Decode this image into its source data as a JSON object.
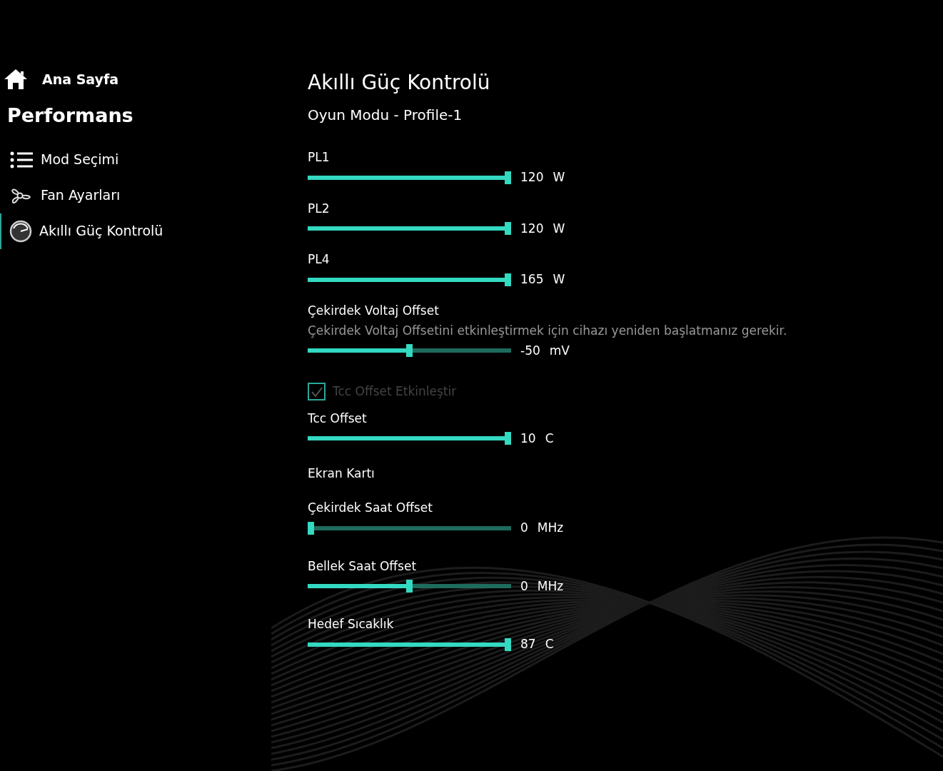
{
  "sidebar": {
    "home": "Ana Sayfa",
    "section": "Performans",
    "items": [
      {
        "label": "Mod Seçimi",
        "kind": "list",
        "selected": false
      },
      {
        "label": "Fan Ayarları",
        "kind": "fan",
        "selected": false
      },
      {
        "label": "Akıllı Güç Kontrolü",
        "kind": "gauge",
        "selected": true
      }
    ]
  },
  "main": {
    "title": "Akıllı Güç Kontrolü",
    "subtitle": "Oyun Modu - Profile-1",
    "controls": [
      {
        "kind": "slider",
        "label": "PL1",
        "level": 1,
        "value": "120",
        "unit": "W"
      },
      {
        "kind": "slider",
        "label": "PL2",
        "level": 1,
        "value": "120",
        "unit": "W"
      },
      {
        "kind": "slider",
        "label": "PL4",
        "level": 1,
        "value": "165",
        "unit": "W"
      },
      {
        "kind": "slider",
        "label": "Çekirdek Voltaj Offset",
        "note": "Çekirdek Voltaj Offsetini etkinleştirmek için cihazı yeniden başlatmanız gerekir.",
        "level": 0.5,
        "value": "-50",
        "unit": "mV"
      },
      {
        "kind": "checkbox",
        "label": "Tcc Offset Etkinleştir",
        "checked": true,
        "disabled": true
      },
      {
        "kind": "slider",
        "label": "Tcc Offset",
        "level": 1,
        "value": "10",
        "unit": "C"
      },
      {
        "kind": "heading",
        "label": "Ekran Kartı"
      },
      {
        "kind": "slider",
        "label": "Çekirdek Saat Offset",
        "level": 0,
        "value": "0",
        "unit": "MHz"
      },
      {
        "kind": "slider",
        "label": "Bellek Saat Offset",
        "level": 0.5,
        "value": "0",
        "unit": "MHz"
      },
      {
        "kind": "slider",
        "label": "Hedef Sıcaklık",
        "level": 1,
        "value": "87",
        "unit": "C"
      }
    ]
  }
}
